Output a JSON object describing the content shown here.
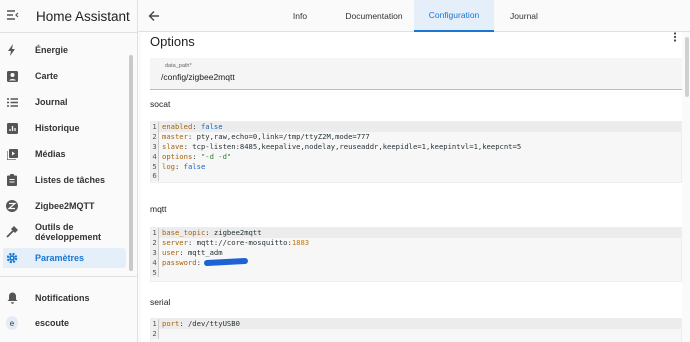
{
  "sidebar": {
    "title": "Home Assistant",
    "items": [
      {
        "label": "Énergie",
        "icon": "lightning-icon"
      },
      {
        "label": "Carte",
        "icon": "account-box-icon"
      },
      {
        "label": "Journal",
        "icon": "list-icon"
      },
      {
        "label": "Historique",
        "icon": "chart-box-icon"
      },
      {
        "label": "Médias",
        "icon": "play-box-icon"
      },
      {
        "label": "Listes de tâches",
        "icon": "clipboard-list-icon"
      },
      {
        "label": "Zigbee2MQTT",
        "icon": "zigbee-icon"
      },
      {
        "label": "Outils de développement",
        "icon": "hammer-icon"
      },
      {
        "label": "Paramètres",
        "icon": "gear-icon"
      }
    ],
    "notifications": "Notifications",
    "user": {
      "initial": "e",
      "name": "escoute"
    }
  },
  "header": {
    "tabs": [
      {
        "label": "Info"
      },
      {
        "label": "Documentation"
      },
      {
        "label": "Configuration"
      },
      {
        "label": "Journal"
      }
    ],
    "active_tab": "Configuration"
  },
  "main": {
    "title": "Options",
    "data_path": {
      "label": "data_path*",
      "value": "/config/zigbee2mqtt"
    },
    "sections": [
      {
        "name": "socat",
        "lines": [
          [
            {
              "t": "enabled",
              "c": "k"
            },
            {
              "t": ": ",
              "c": "v"
            },
            {
              "t": "false",
              "c": "b"
            }
          ],
          [
            {
              "t": "master",
              "c": "k"
            },
            {
              "t": ": pty,raw,echo=0,link=/tmp/ttyZ2M,mode=777",
              "c": "v"
            }
          ],
          [
            {
              "t": "slave",
              "c": "k"
            },
            {
              "t": ": tcp-listen:8485,keepalive,nodelay,reuseaddr,keepidle=1,keepintvl=1,keepcnt=5",
              "c": "v"
            }
          ],
          [
            {
              "t": "options",
              "c": "k"
            },
            {
              "t": ": ",
              "c": "v"
            },
            {
              "t": "\"-d -d\"",
              "c": "s"
            }
          ],
          [
            {
              "t": "log",
              "c": "k"
            },
            {
              "t": ": ",
              "c": "v"
            },
            {
              "t": "false",
              "c": "b"
            }
          ],
          []
        ]
      },
      {
        "name": "mqtt",
        "lines": [
          [
            {
              "t": "base_topic",
              "c": "k"
            },
            {
              "t": ": zigbee2mqtt",
              "c": "v"
            }
          ],
          [
            {
              "t": "server",
              "c": "k"
            },
            {
              "t": ": mqtt://core-mosquitto:",
              "c": "v"
            },
            {
              "t": "1883",
              "c": "n"
            }
          ],
          [
            {
              "t": "user",
              "c": "k"
            },
            {
              "t": ": mqtt_adm",
              "c": "v"
            }
          ],
          [
            {
              "t": "password",
              "c": "k"
            },
            {
              "t": ":",
              "c": "v"
            },
            {
              "t": "",
              "c": "redacted"
            }
          ],
          []
        ]
      },
      {
        "name": "serial",
        "lines": [
          [
            {
              "t": "port",
              "c": "k"
            },
            {
              "t": ": /dev/ttyUSB0",
              "c": "v"
            }
          ],
          []
        ]
      }
    ]
  }
}
